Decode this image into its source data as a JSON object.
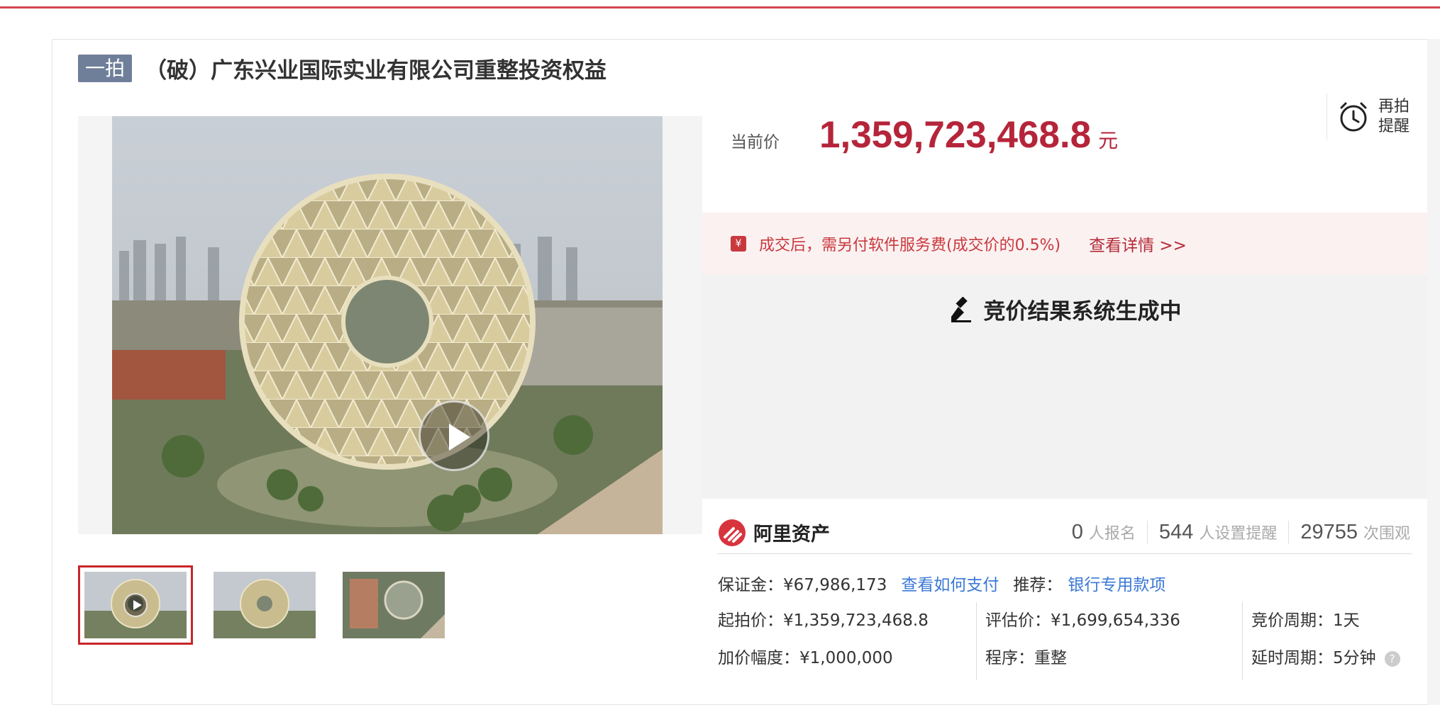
{
  "header": {
    "round_badge": "一拍",
    "title": "（破）广东兴业国际实业有限公司重整投资权益"
  },
  "media": {
    "thumbnails": [
      "video-thumb",
      "photo-thumb",
      "aerial-thumb"
    ],
    "active_thumbnail": 0
  },
  "price": {
    "label": "当前价",
    "value": "1,359,723,468.8",
    "unit": "元"
  },
  "remind": {
    "label": "再拍提醒",
    "icon": "alarm-clock-icon"
  },
  "fee_notice": {
    "icon": "yen-tag-icon",
    "text": "成交后，需另付软件服务费(成交价的0.5%)",
    "link": "查看详情 >>"
  },
  "result": {
    "icon": "gavel-icon",
    "text": "竞价结果系统生成中"
  },
  "brand": {
    "name": "阿里资产",
    "color": "#d8343e"
  },
  "stats": [
    {
      "num": "0",
      "label": "人报名"
    },
    {
      "num": "544",
      "label": "人设置提醒"
    },
    {
      "num": "29755",
      "label": "次围观"
    }
  ],
  "deposit": {
    "label": "保证金：¥67,986,173",
    "pay_link": "查看如何支付",
    "recommend_label": "推荐：",
    "recommend_link": "银行专用款项"
  },
  "info": {
    "start_price": "起拍价：¥1,359,723,468.8",
    "increment": "加价幅度：¥1,000,000",
    "appraisal": "评估价：¥1,699,654,336",
    "procedure": "程序：重整",
    "bid_period": "竞价周期：1天",
    "delay_period": "延时周期：5分钟"
  },
  "colors": {
    "accent_red": "#b5253a",
    "badge_gray": "#6f7f9a",
    "link_blue": "#3a79d6"
  }
}
